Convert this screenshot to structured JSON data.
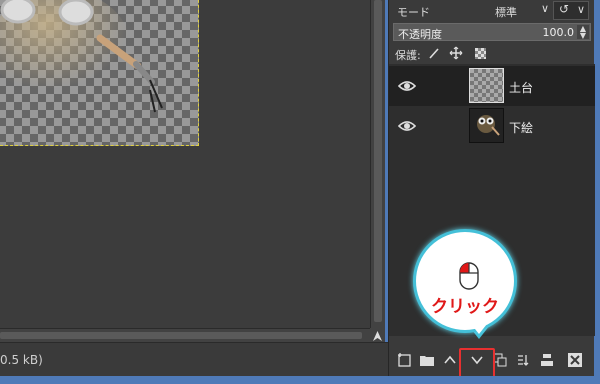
{
  "status_bar": {
    "text": "0.5 kB)"
  },
  "layers_panel": {
    "mode_label": "モード",
    "mode_value": "標準",
    "mode_chevron": "∨",
    "reset_icon": "↺",
    "reset_chevron": "∨",
    "opacity_label": "不透明度",
    "opacity_value": "100.0",
    "lock_label": "保護:",
    "layers": [
      {
        "name": "土台",
        "visible": true,
        "active": true,
        "thumb": "transparent-checker"
      },
      {
        "name": "下絵",
        "visible": true,
        "active": false,
        "thumb": "sketch"
      }
    ],
    "toolbar_icons": [
      "new-layer-icon",
      "new-layer-group-icon",
      "raise-layer-icon",
      "lower-layer-icon",
      "duplicate-layer-icon",
      "anchor-layer-icon",
      "merge-down-icon",
      "delete-layer-icon"
    ]
  },
  "callout": {
    "text": "クリック",
    "icon": "mouse-left-click-icon",
    "color": "#e01818"
  },
  "colors": {
    "panel_bg": "#3a3a3a",
    "highlight": "#e83030",
    "callout_border": "#44c0d8"
  }
}
